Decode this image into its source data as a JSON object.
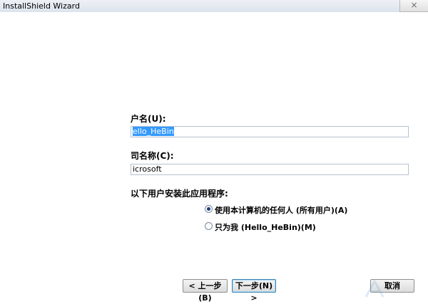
{
  "window": {
    "title": "InstallShield Wizard",
    "close_glyph": "×"
  },
  "form": {
    "user_name_label": "户名(U):",
    "user_name_value": "ello_HeBin",
    "org_label": "司名称(C):",
    "org_value": "icrosoft",
    "install_for_label": "以下用户安装此应用程序:",
    "options": [
      {
        "label": "使用本计算机的任何人 (所有用户)(A)",
        "selected": true
      },
      {
        "label": "只为我 (Hello_HeBin)(M)",
        "selected": false
      }
    ]
  },
  "buttons": {
    "back": "< 上一步(B)",
    "next": "下一步(N) >",
    "cancel": "取消"
  },
  "icons": [
    "close-icon",
    "radio-selected-icon",
    "radio-empty-icon",
    "watermark-logo"
  ]
}
